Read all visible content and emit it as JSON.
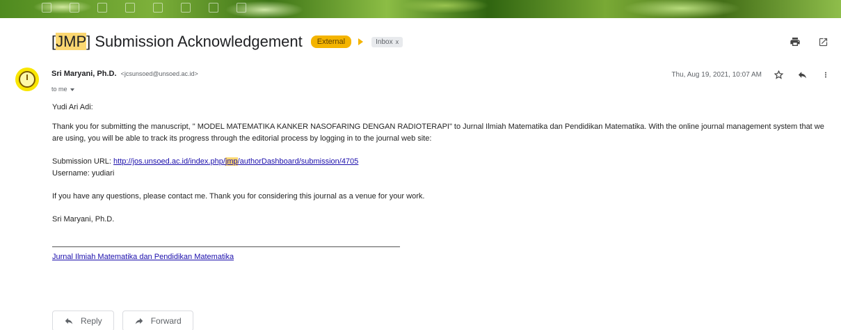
{
  "email": {
    "subject_prefix_bracket_open": "[",
    "subject_prefix_highlight": "JMP",
    "subject_prefix_bracket_close": "]",
    "subject_rest": " Submission Acknowledgement",
    "badge_external": "External",
    "label_inbox": "Inbox",
    "label_close": "x",
    "sender_name": "Sri Maryani, Ph.D.",
    "sender_email": "<jcsunsoed@unsoed.ac.id>",
    "to_line": "to me",
    "date": "Thu, Aug 19, 2021, 10:07 AM"
  },
  "body": {
    "greeting": "Yudi Ari Adi:",
    "paragraph1": "Thank you for submitting the manuscript, \" MODEL MATEMATIKA KANKER NASOFARING DENGAN RADIOTERAPI\" to Jurnal Ilmiah Matematika dan Pendidikan Matematika. With the online journal management system that we are using, you will be able to track its progress through the editorial process by logging in to the journal web site:",
    "submission_url_label": "Submission URL: ",
    "submission_url_start": "http://jos.unsoed.ac.id/index.php/",
    "submission_url_highlight": "jmp",
    "submission_url_end": "/authorDashboard/submission/4705",
    "username_line": "Username: yudiari",
    "paragraph2": "If you have any questions, please contact me. Thank you for considering this journal as a venue for your work.",
    "signature": "Sri Maryani, Ph.D.",
    "journal_link": "Jurnal Ilmiah Matematika dan Pendidikan Matematika"
  },
  "actions": {
    "reply_label": "Reply",
    "forward_label": "Forward"
  },
  "icons": {
    "print": "print-icon",
    "open_new_window": "open-in-new-icon",
    "star": "star-icon",
    "reply": "reply-icon",
    "more": "more-vert-icon",
    "forward": "forward-icon"
  },
  "colors": {
    "highlight": "#fbd771",
    "external_badge": "#f4b400",
    "link": "#1a0dab",
    "avatar": "#f9e600"
  }
}
